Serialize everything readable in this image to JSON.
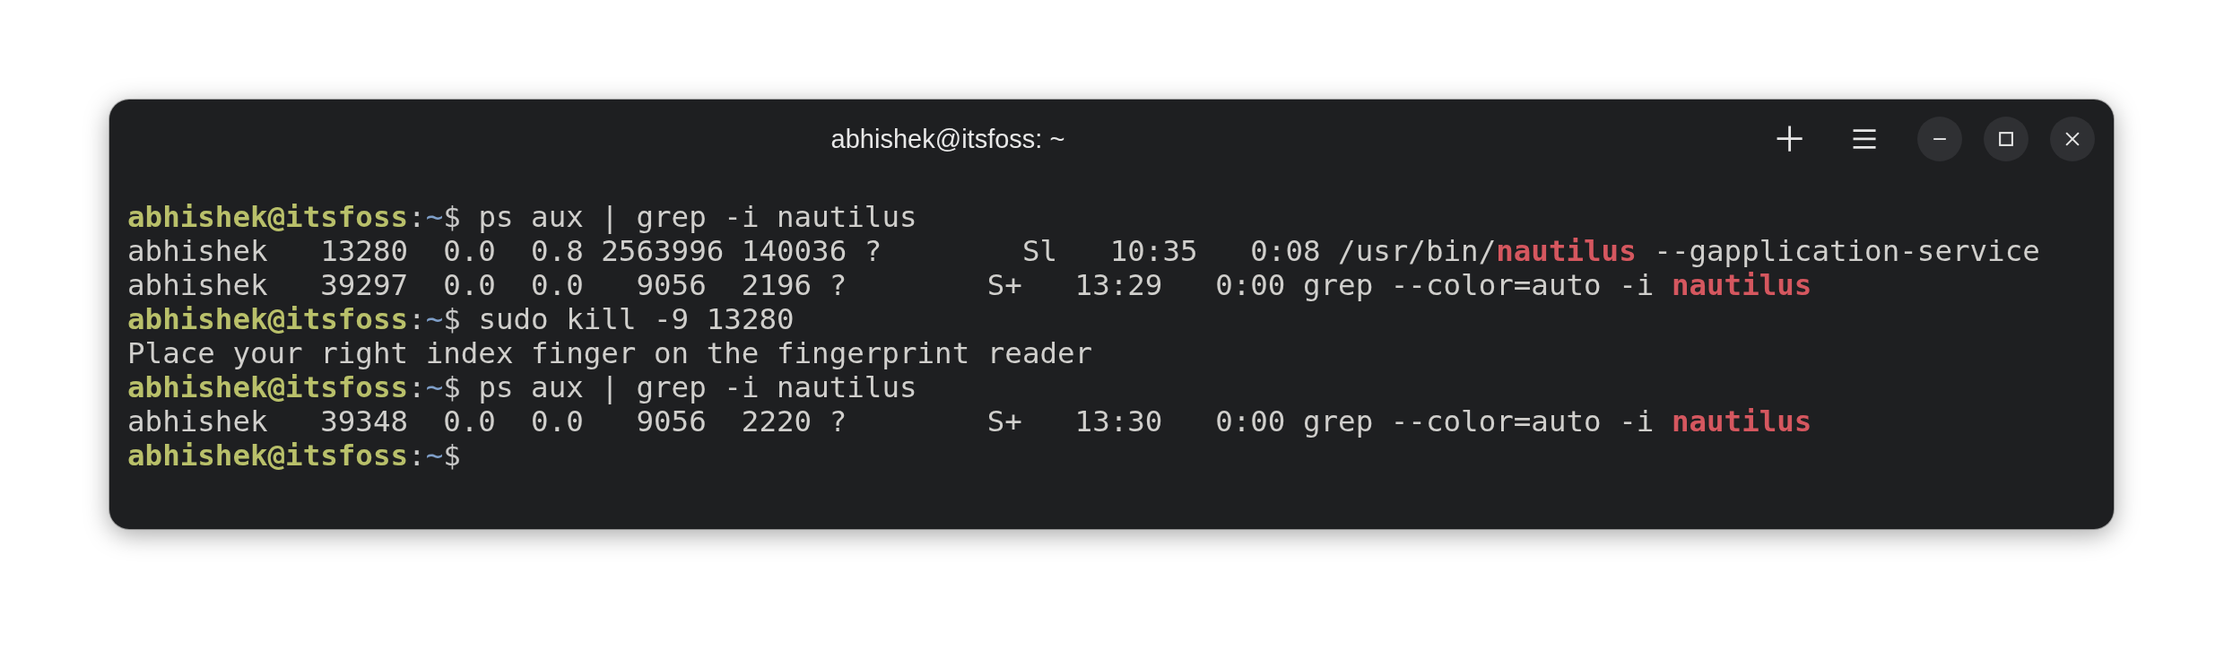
{
  "window": {
    "title": "abhishek@itsfoss: ~"
  },
  "header_buttons": [
    {
      "kind": "new-tab"
    },
    {
      "kind": "menu"
    }
  ],
  "window_controls": [
    {
      "kind": "minimize"
    },
    {
      "kind": "maximize"
    },
    {
      "kind": "close"
    }
  ],
  "terminal_lines": [
    {
      "segments": [
        {
          "kind": "user",
          "text": "abhishek@itsfoss"
        },
        {
          "kind": "sep",
          "text": ":"
        },
        {
          "kind": "path",
          "text": "~"
        },
        {
          "kind": "sep",
          "text": "$"
        },
        {
          "kind": "plain",
          "text": " ps aux | grep -i nautilus"
        }
      ]
    },
    {
      "segments": [
        {
          "kind": "plain",
          "text": "abhishek   13280  0.0  0.8 2563996 140036 ?        Sl   10:35   0:08 /usr/bin/"
        },
        {
          "kind": "match",
          "text": "nautilus"
        },
        {
          "kind": "plain",
          "text": " --gapplication-service"
        }
      ]
    },
    {
      "segments": [
        {
          "kind": "plain",
          "text": "abhishek   39297  0.0  0.0   9056  2196 ?        S+   13:29   0:00 grep --color=auto -i "
        },
        {
          "kind": "match",
          "text": "nautilus"
        }
      ]
    },
    {
      "segments": [
        {
          "kind": "user",
          "text": "abhishek@itsfoss"
        },
        {
          "kind": "sep",
          "text": ":"
        },
        {
          "kind": "path",
          "text": "~"
        },
        {
          "kind": "sep",
          "text": "$"
        },
        {
          "kind": "plain",
          "text": " sudo kill -9 13280"
        }
      ]
    },
    {
      "segments": [
        {
          "kind": "plain",
          "text": "Place your right index finger on the fingerprint reader"
        }
      ]
    },
    {
      "segments": [
        {
          "kind": "user",
          "text": "abhishek@itsfoss"
        },
        {
          "kind": "sep",
          "text": ":"
        },
        {
          "kind": "path",
          "text": "~"
        },
        {
          "kind": "sep",
          "text": "$"
        },
        {
          "kind": "plain",
          "text": " ps aux | grep -i nautilus"
        }
      ]
    },
    {
      "segments": [
        {
          "kind": "plain",
          "text": "abhishek   39348  0.0  0.0   9056  2220 ?        S+   13:30   0:00 grep --color=auto -i "
        },
        {
          "kind": "match",
          "text": "nautilus"
        }
      ]
    },
    {
      "segments": [
        {
          "kind": "user",
          "text": "abhishek@itsfoss"
        },
        {
          "kind": "sep",
          "text": ":"
        },
        {
          "kind": "path",
          "text": "~"
        },
        {
          "kind": "sep",
          "text": "$"
        }
      ]
    }
  ]
}
